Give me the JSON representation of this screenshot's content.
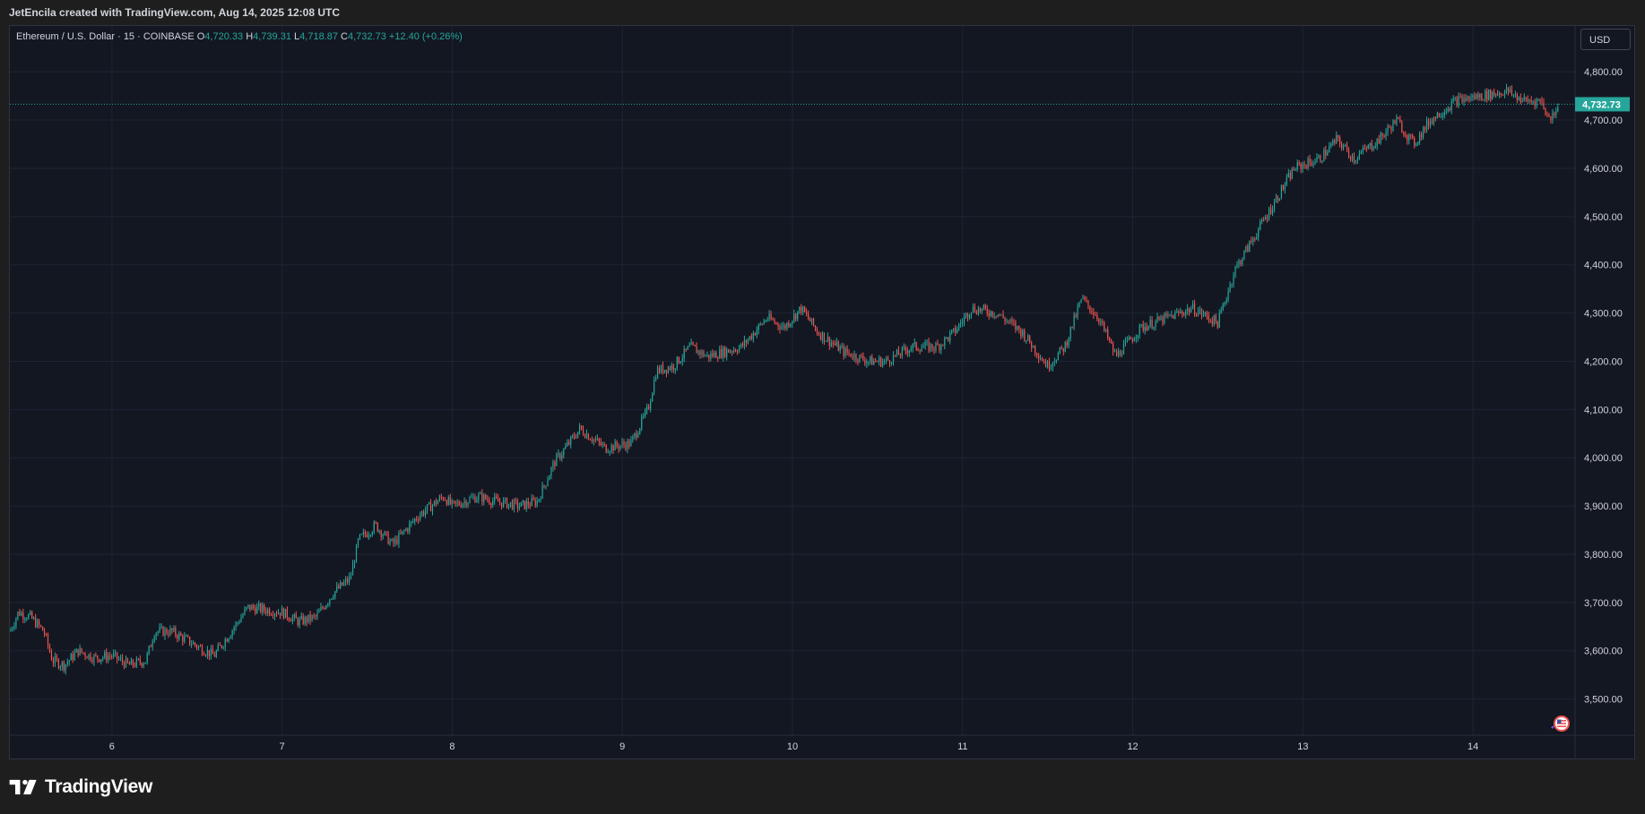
{
  "header": {
    "attribution": "JetEncila created with TradingView.com, Aug 14, 2025 12:08 UTC"
  },
  "legend": {
    "symbol": "Ethereum / U.S. Dollar · 15 · COINBASE",
    "o_label": "O",
    "o_value": "4,720.33",
    "h_label": "H",
    "h_value": "4,739.31",
    "l_label": "L",
    "l_value": "4,718.87",
    "c_label": "C",
    "c_value": "4,732.73",
    "change": "+12.40 (+0.26%)"
  },
  "currency_button": {
    "label": "USD"
  },
  "brand": {
    "name": "TradingView",
    "logo_icon": "tradingview-logo-icon"
  },
  "colors": {
    "background": "#131722",
    "up": "#26a69a",
    "down": "#ef5350",
    "grid": "#1f2433",
    "axis_text": "#d1d4dc",
    "last_price_bg": "#26a69a"
  },
  "chart_data": {
    "type": "candlestick",
    "timeframe": "15",
    "x_unit": "day of August 2025",
    "xlim": [
      5.4,
      14.6
    ],
    "ylim": [
      3425,
      4895
    ],
    "y_ticks": [
      3500,
      3600,
      3700,
      3800,
      3900,
      4000,
      4100,
      4200,
      4300,
      4400,
      4500,
      4600,
      4700,
      4800
    ],
    "y_tick_labels": [
      "3,500.00",
      "3,600.00",
      "3,700.00",
      "3,800.00",
      "3,900.00",
      "4,000.00",
      "4,100.00",
      "4,200.00",
      "4,300.00",
      "4,400.00",
      "4,500.00",
      "4,600.00",
      "4,700.00",
      "4,800.00"
    ],
    "x_ticks": [
      6,
      7,
      8,
      9,
      10,
      11,
      12,
      13,
      14
    ],
    "x_tick_labels": [
      "6",
      "7",
      "8",
      "9",
      "10",
      "11",
      "12",
      "13",
      "14"
    ],
    "last_price": 4732.73,
    "last_price_label": "4,732.73",
    "grid": true,
    "price_path": [
      [
        5.4,
        3640
      ],
      [
        5.45,
        3680
      ],
      [
        5.52,
        3670
      ],
      [
        5.6,
        3640
      ],
      [
        5.65,
        3580
      ],
      [
        5.72,
        3570
      ],
      [
        5.8,
        3600
      ],
      [
        5.9,
        3585
      ],
      [
        6.0,
        3590
      ],
      [
        6.1,
        3570
      ],
      [
        6.2,
        3580
      ],
      [
        6.25,
        3640
      ],
      [
        6.35,
        3640
      ],
      [
        6.5,
        3610
      ],
      [
        6.6,
        3590
      ],
      [
        6.7,
        3640
      ],
      [
        6.8,
        3690
      ],
      [
        7.0,
        3680
      ],
      [
        7.1,
        3660
      ],
      [
        7.2,
        3670
      ],
      [
        7.3,
        3720
      ],
      [
        7.4,
        3750
      ],
      [
        7.45,
        3830
      ],
      [
        7.55,
        3860
      ],
      [
        7.65,
        3820
      ],
      [
        7.8,
        3880
      ],
      [
        7.95,
        3920
      ],
      [
        8.0,
        3900
      ],
      [
        8.15,
        3920
      ],
      [
        8.25,
        3910
      ],
      [
        8.4,
        3900
      ],
      [
        8.5,
        3910
      ],
      [
        8.6,
        3990
      ],
      [
        8.75,
        4060
      ],
      [
        8.9,
        4020
      ],
      [
        9.05,
        4030
      ],
      [
        9.15,
        4100
      ],
      [
        9.2,
        4180
      ],
      [
        9.3,
        4190
      ],
      [
        9.4,
        4230
      ],
      [
        9.5,
        4210
      ],
      [
        9.7,
        4230
      ],
      [
        9.85,
        4290
      ],
      [
        9.95,
        4270
      ],
      [
        10.05,
        4310
      ],
      [
        10.15,
        4260
      ],
      [
        10.3,
        4220
      ],
      [
        10.45,
        4200
      ],
      [
        10.55,
        4200
      ],
      [
        10.7,
        4230
      ],
      [
        10.85,
        4230
      ],
      [
        10.95,
        4260
      ],
      [
        11.05,
        4310
      ],
      [
        11.2,
        4300
      ],
      [
        11.35,
        4260
      ],
      [
        11.5,
        4190
      ],
      [
        11.6,
        4230
      ],
      [
        11.7,
        4330
      ],
      [
        11.8,
        4290
      ],
      [
        11.9,
        4210
      ],
      [
        12.05,
        4270
      ],
      [
        12.2,
        4290
      ],
      [
        12.35,
        4310
      ],
      [
        12.5,
        4280
      ],
      [
        12.6,
        4390
      ],
      [
        12.75,
        4480
      ],
      [
        12.85,
        4540
      ],
      [
        12.95,
        4600
      ],
      [
        13.1,
        4620
      ],
      [
        13.2,
        4660
      ],
      [
        13.3,
        4620
      ],
      [
        13.45,
        4660
      ],
      [
        13.55,
        4700
      ],
      [
        13.65,
        4650
      ],
      [
        13.75,
        4700
      ],
      [
        13.9,
        4740
      ],
      [
        14.05,
        4750
      ],
      [
        14.2,
        4760
      ],
      [
        14.3,
        4740
      ],
      [
        14.4,
        4740
      ],
      [
        14.45,
        4700
      ],
      [
        14.5,
        4732.73
      ]
    ]
  }
}
